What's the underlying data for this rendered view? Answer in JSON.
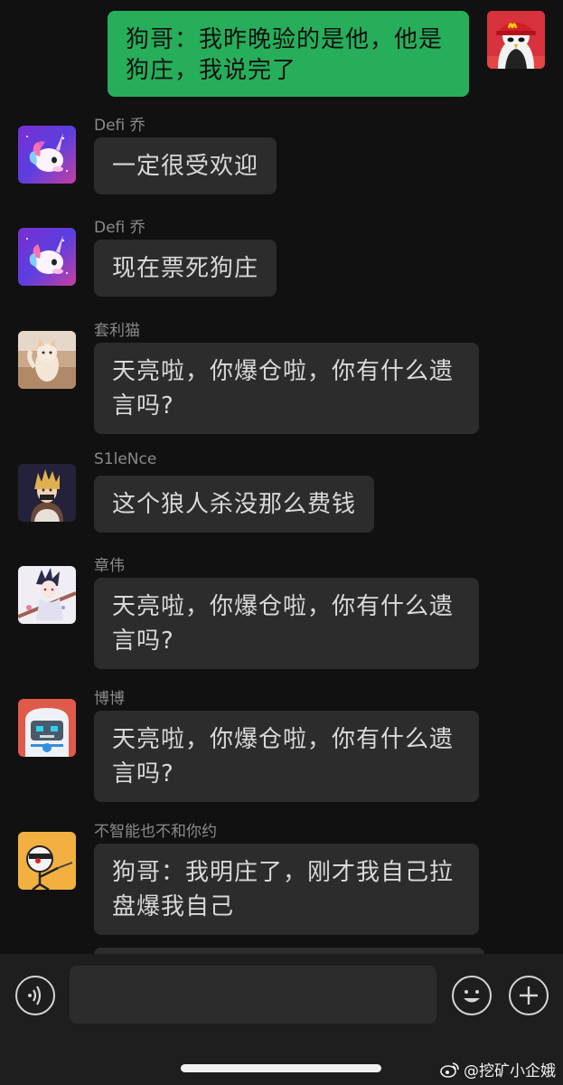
{
  "self_message": {
    "text": "狗哥：我昨晚验的是他，他是狗庄，我说完了"
  },
  "messages": [
    {
      "sender": "Defi 乔",
      "text": "一定很受欢迎"
    },
    {
      "sender": "Defi 乔",
      "text": "现在票死狗庄"
    },
    {
      "sender": "套利猫",
      "text": "天亮啦，你爆仓啦，你有什么遗言吗?"
    },
    {
      "sender": "S1leNce",
      "text": "这个狼人杀没那么费钱"
    },
    {
      "sender": "章伟",
      "text": "天亮啦，你爆仓啦，你有什么遗言吗?"
    },
    {
      "sender": "博博",
      "text": "天亮啦，你爆仓啦，你有什么遗言吗?"
    },
    {
      "sender": "不智能也不和你约",
      "text": "狗哥：我明庄了，刚才我自己拉盘爆我自己"
    }
  ],
  "input": {
    "value": "",
    "placeholder": ""
  },
  "watermark": {
    "text": "@挖矿小企娥"
  },
  "colors": {
    "background": "#111111",
    "self_bubble": "#27ae5a",
    "other_bubble": "#2c2c2c",
    "sender_name": "#8a8a8a",
    "input_bar": "#1e1e1e"
  },
  "icons": {
    "voice": "voice-wave-icon",
    "emoji": "smiley-icon",
    "add": "plus-icon",
    "watermark_logo": "weibo-logo-icon"
  }
}
